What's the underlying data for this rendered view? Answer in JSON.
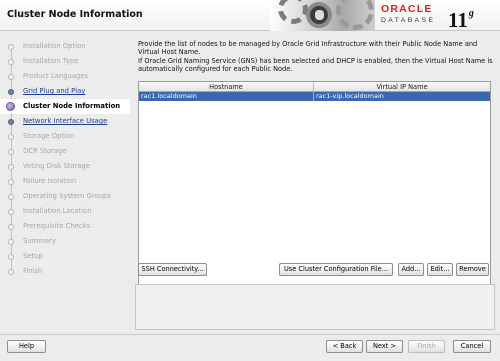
{
  "header": {
    "title": "Cluster Node Information",
    "brand": "ORACLE",
    "product": "DATABASE",
    "version_number": "11",
    "version_letter": "g"
  },
  "sidebar": {
    "items": [
      {
        "label": "Installation Option",
        "state": "done"
      },
      {
        "label": "Installation Type",
        "state": "done"
      },
      {
        "label": "Product Languages",
        "state": "done"
      },
      {
        "label": "Grid Plug and Play",
        "state": "link"
      },
      {
        "label": "Cluster Node Information",
        "state": "current"
      },
      {
        "label": "Network Interface Usage",
        "state": "link"
      },
      {
        "label": "Storage Option",
        "state": "pending"
      },
      {
        "label": "OCR Storage",
        "state": "pending"
      },
      {
        "label": "Voting Disk Storage",
        "state": "pending"
      },
      {
        "label": "Failure Isolation",
        "state": "pending"
      },
      {
        "label": "Operating System Groups",
        "state": "pending"
      },
      {
        "label": "Installation Location",
        "state": "pending"
      },
      {
        "label": "Prerequisite Checks",
        "state": "pending"
      },
      {
        "label": "Summary",
        "state": "pending"
      },
      {
        "label": "Setup",
        "state": "pending"
      },
      {
        "label": "Finish",
        "state": "pending"
      }
    ]
  },
  "main": {
    "desc_line1": "Provide the list of nodes to be managed by Oracle Grid Infrastructure with their Public Node Name and Virtual Host Name.",
    "desc_line2": "If Oracle Grid Naming Service (GNS) has been selected and DHCP is enabled, then the Virtual Host Name is automatically configured for each Public Node.",
    "table": {
      "headers": [
        "Hostname",
        "Virtual IP Name"
      ],
      "rows": [
        [
          "rac1.localdomain",
          "rac1-vip.localdomain"
        ]
      ]
    },
    "buttons": {
      "ssh": "SSH Connectivity...",
      "use_cluster_config": "Use Cluster Configuration File...",
      "add": "Add...",
      "edit": "Edit...",
      "remove": "Remove"
    }
  },
  "footer": {
    "help": "Help",
    "back": "< Back",
    "next": "Next >",
    "finish": "Finish",
    "cancel": "Cancel"
  },
  "colors": {
    "selection": "#3a67b0",
    "brand_red": "#e01e1e",
    "link": "#1a3f8a"
  }
}
